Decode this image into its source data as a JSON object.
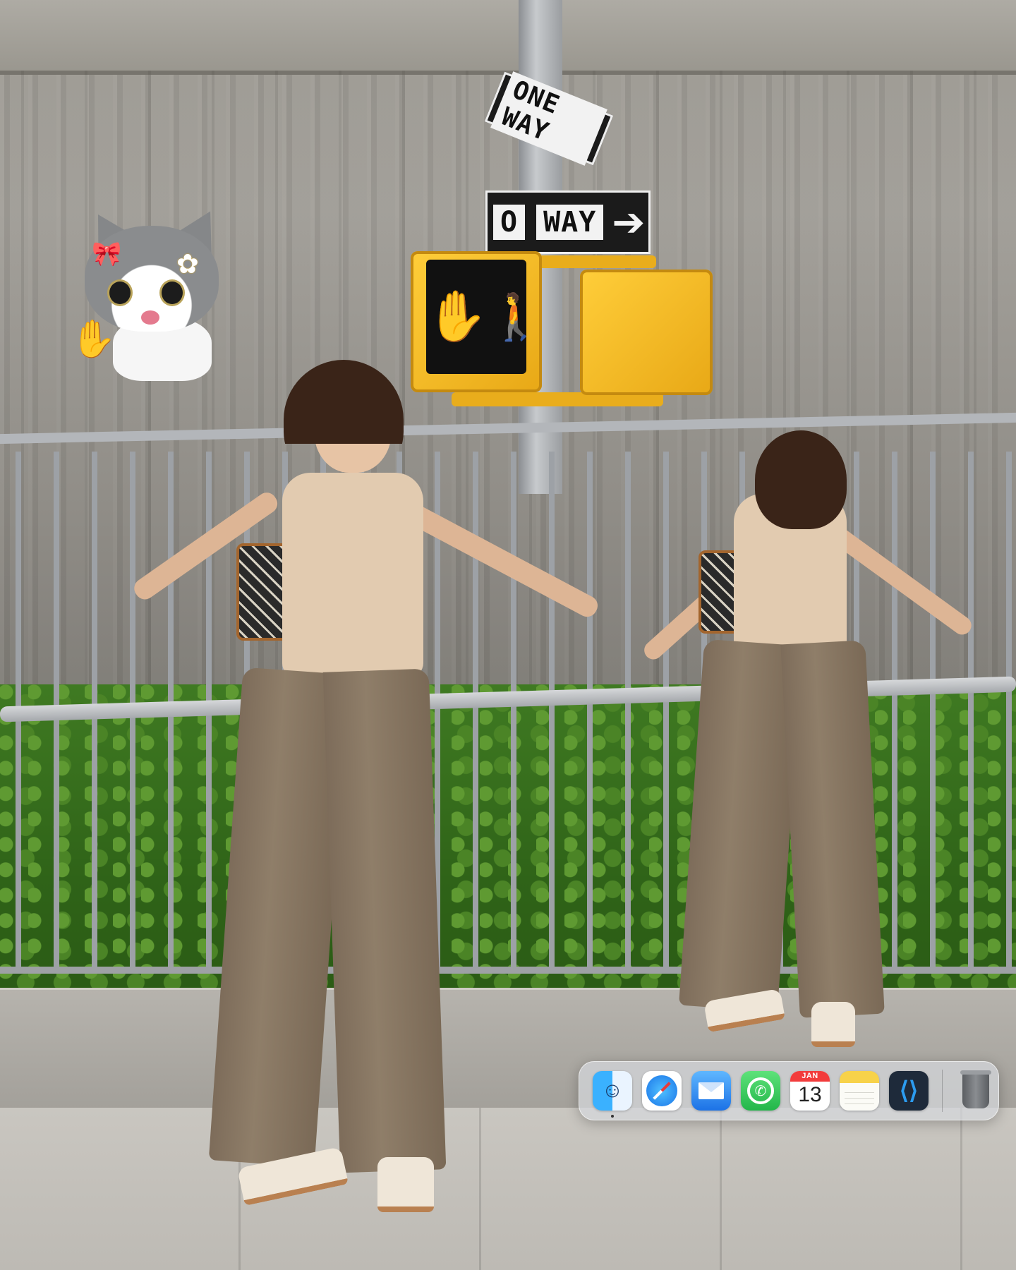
{
  "signs": {
    "top_sign": "ONE WAY",
    "lower_sign_left": "O",
    "lower_sign_right": "WAY"
  },
  "dock": {
    "apps": [
      {
        "id": "finder",
        "icon": "finder-icon",
        "running": true
      },
      {
        "id": "safari",
        "icon": "compass-icon",
        "running": false
      },
      {
        "id": "mail",
        "icon": "envelope-icon",
        "running": false
      },
      {
        "id": "whatsapp",
        "icon": "phone-bubble-icon",
        "running": false
      },
      {
        "id": "calendar",
        "icon": "calendar-icon",
        "running": false
      },
      {
        "id": "notes",
        "icon": "notepad-icon",
        "running": false
      },
      {
        "id": "vscode",
        "icon": "vscode-icon",
        "running": false
      }
    ],
    "calendar_month": "JAN",
    "calendar_day": "13",
    "trash_icon": "trash-icon"
  },
  "colors": {
    "signal_yellow": "#f2b51c",
    "pants": "#857360",
    "top": "#e2cbb0"
  }
}
